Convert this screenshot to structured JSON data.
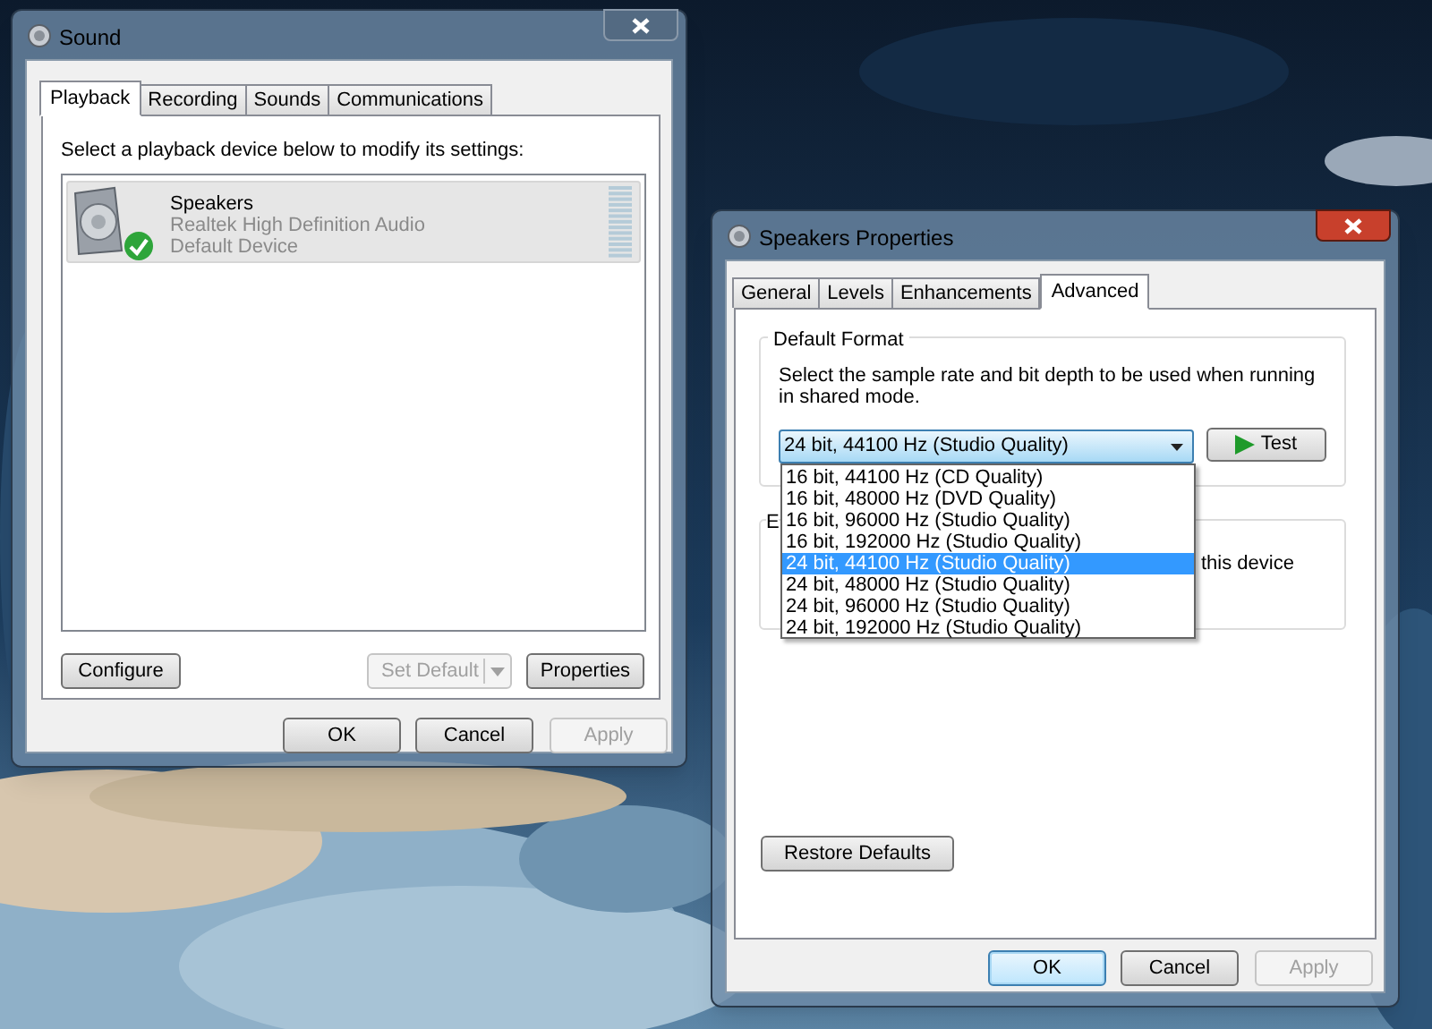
{
  "sound_window": {
    "title": "Sound",
    "active": false,
    "tabs": [
      {
        "label": "Playback",
        "selected": true
      },
      {
        "label": "Recording",
        "selected": false
      },
      {
        "label": "Sounds",
        "selected": false
      },
      {
        "label": "Communications",
        "selected": false
      }
    ],
    "instruction": "Select a playback device below to modify its settings:",
    "devices": [
      {
        "name": "Speakers",
        "driver": "Realtek High Definition Audio",
        "status": "Default Device",
        "selected": true,
        "default": true
      }
    ],
    "buttons": [
      {
        "label": "Configure",
        "kind": "push",
        "disabled": false
      },
      {
        "label": "Set Default",
        "kind": "split",
        "disabled": true
      },
      {
        "label": "Properties",
        "kind": "push",
        "disabled": false
      }
    ],
    "dialog_buttons": [
      {
        "label": "OK",
        "disabled": false,
        "focused": false
      },
      {
        "label": "Cancel",
        "disabled": false,
        "focused": false
      },
      {
        "label": "Apply",
        "disabled": true,
        "focused": false
      }
    ]
  },
  "properties_window": {
    "title": "Speakers Properties",
    "active": true,
    "tabs": [
      {
        "label": "General",
        "selected": false
      },
      {
        "label": "Levels",
        "selected": false
      },
      {
        "label": "Enhancements",
        "selected": false
      },
      {
        "label": "Advanced",
        "selected": true
      }
    ],
    "default_format": {
      "title": "Default Format",
      "description": "Select the sample rate and bit depth to be used when running in shared mode.",
      "value": "24 bit, 44100 Hz (Studio Quality)",
      "test_button": "Test"
    },
    "format_options": [
      {
        "label": "16 bit, 44100 Hz (CD Quality)",
        "selected": false
      },
      {
        "label": "16 bit, 48000 Hz (DVD Quality)",
        "selected": false
      },
      {
        "label": "16 bit, 96000 Hz (Studio Quality)",
        "selected": false
      },
      {
        "label": "16 bit, 192000 Hz (Studio Quality)",
        "selected": false
      },
      {
        "label": "24 bit, 44100 Hz (Studio Quality)",
        "selected": true
      },
      {
        "label": "24 bit, 48000 Hz (Studio Quality)",
        "selected": false
      },
      {
        "label": "24 bit, 96000 Hz (Studio Quality)",
        "selected": false
      },
      {
        "label": "24 bit, 192000 Hz (Studio Quality)",
        "selected": false
      }
    ],
    "exclusive_group": {
      "title": "E",
      "text": "this device"
    },
    "restore_button": "Restore Defaults",
    "dialog_buttons": [
      {
        "label": "OK",
        "disabled": false,
        "focused": true
      },
      {
        "label": "Cancel",
        "disabled": false,
        "focused": false
      },
      {
        "label": "Apply",
        "disabled": true,
        "focused": false
      }
    ]
  }
}
